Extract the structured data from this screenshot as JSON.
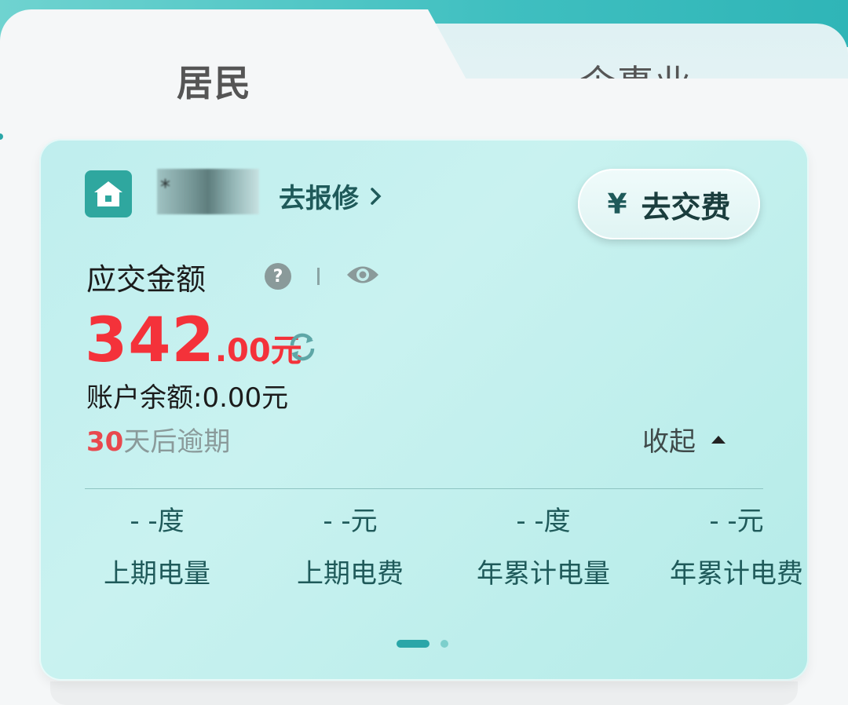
{
  "tabs": {
    "resident_label": "居民",
    "business_label": "企事业"
  },
  "card": {
    "account_masked": "*",
    "repair_label": "去报修",
    "pay_button": {
      "icon": "yen-icon",
      "label": "去交费"
    },
    "due_label": "应交金额",
    "amount_integer": "342",
    "amount_decimal": ".00元",
    "balance": "账户余额:0.00元",
    "overdue_days": "30",
    "overdue_suffix": "天后逾期",
    "collapse_label": "收起",
    "stats": [
      {
        "value": "- -度",
        "label": "上期电量"
      },
      {
        "value": "- -元",
        "label": "上期电费"
      },
      {
        "value": "- -度",
        "label": "年累计电量"
      },
      {
        "value": "- -元",
        "label": "年累计电费"
      }
    ],
    "pager": {
      "current": 1,
      "total": 2
    }
  },
  "colors": {
    "accent": "#2fa79f",
    "amount": "#f4323a",
    "overdue": "#e8484e",
    "card_bg": "#c0eeee"
  }
}
